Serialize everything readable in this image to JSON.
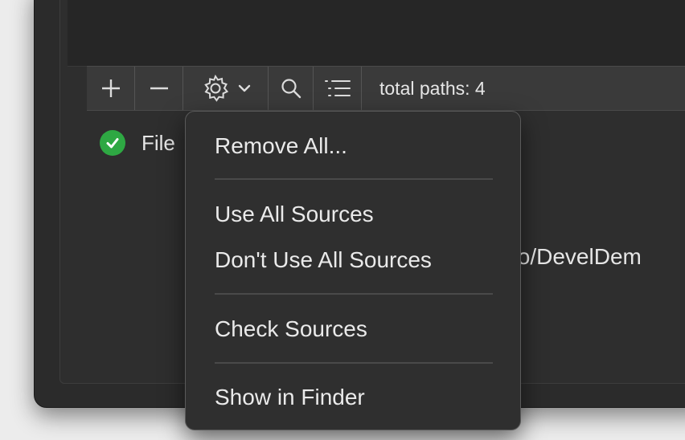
{
  "toolbar": {
    "add_icon": "plus-icon",
    "remove_icon": "minus-icon",
    "settings_icon": "gear-icon",
    "dropdown_icon": "chevron-down-icon",
    "search_icon": "search-icon",
    "list_icon": "list-icon",
    "status": "total paths: 4"
  },
  "file_row": {
    "status_icon": "checkmark-circle-icon",
    "label": "File",
    "path_fragment": "to/DevelDem"
  },
  "menu": {
    "items": [
      "Remove All...",
      "Use All Sources",
      "Don't Use All Sources",
      "Check Sources",
      "Show in Finder"
    ]
  },
  "colors": {
    "check_green": "#2ea843",
    "menu_bg": "#2f2f2f",
    "toolbar_bg": "#3a3a3a"
  }
}
